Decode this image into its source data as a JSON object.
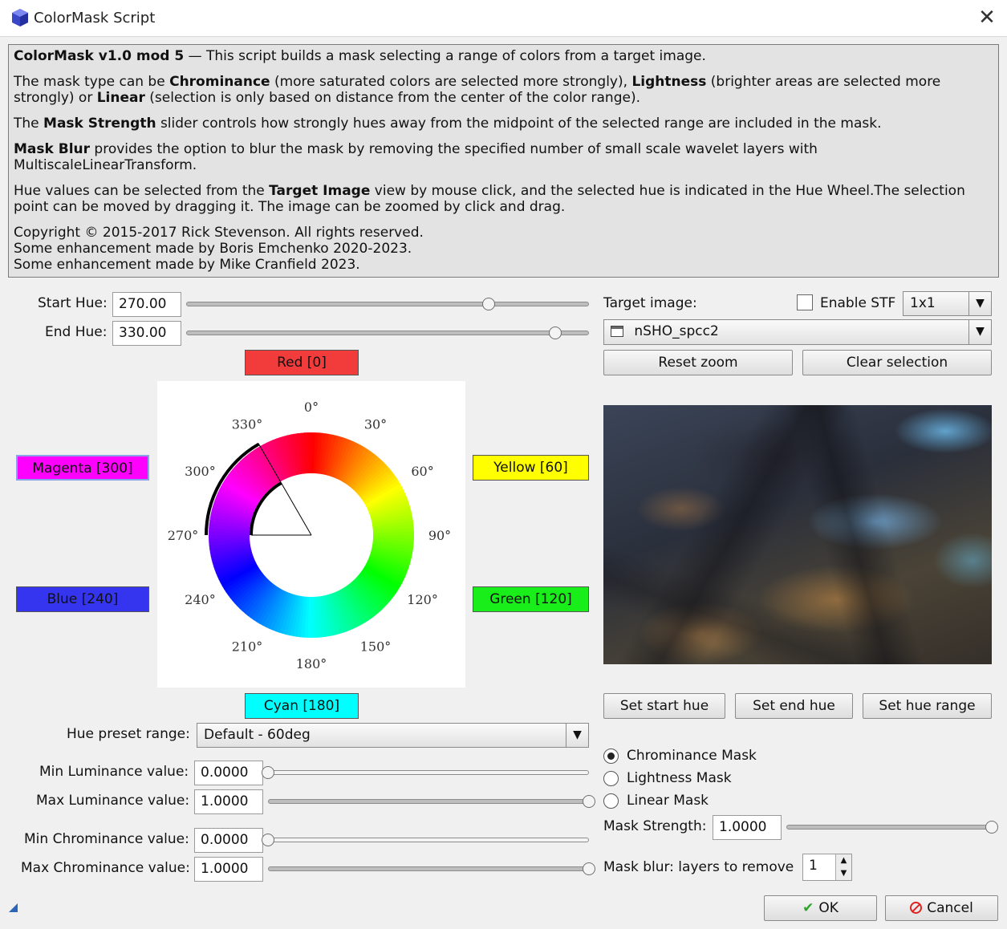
{
  "window": {
    "title": "ColorMask Script",
    "close_glyph": "✕",
    "icon": "app-cube-icon"
  },
  "description": {
    "p1": {
      "b1": "ColorMask v1.0 mod 5",
      "t1": " — This script builds a mask selecting a range of colors from a target image."
    },
    "p2": {
      "t1": "The mask type can be ",
      "b1": "Chrominance",
      "t2": " (more saturated colors are selected more strongly), ",
      "b2": "Lightness",
      "t3": " (brighter areas are selected more strongly) or ",
      "b3": "Linear",
      "t4": " (selection is only based on distance from the center of the color range)."
    },
    "p3": {
      "t1": "The ",
      "b1": "Mask Strength",
      "t2": " slider controls how strongly hues away from the midpoint of the selected range are included in the mask."
    },
    "p4": {
      "b1": "Mask Blur",
      "t1": " provides the option to blur the mask by removing the specified number of small scale wavelet layers with MultiscaleLinearTransform."
    },
    "p5": {
      "t1": "Hue values can be selected from the ",
      "b1": "Target Image",
      "t2": " view by mouse click, and the selected hue is indicated in the Hue Wheel.The selection point can be moved by dragging it. The image can be zoomed by click and drag."
    },
    "p6": {
      "l1": "Copyright © 2015-2017 Rick Stevenson. All rights reserved.",
      "l2": "Some enhancement made by Boris Emchenko 2020-2023.",
      "l3": "Some enhancement made by Mike Cranfield 2023."
    }
  },
  "hue": {
    "start_label": "Start Hue:",
    "start_value": "270.00",
    "start_position": 0.75,
    "end_label": "End Hue:",
    "end_value": "330.00",
    "end_position": 0.9167
  },
  "hue_buttons": {
    "red": {
      "label": "Red [0]",
      "color": "#f23b3b"
    },
    "yellow": {
      "label": "Yellow [60]",
      "color": "#ffff00"
    },
    "green": {
      "label": "Green [120]",
      "color": "#1aee1a"
    },
    "cyan": {
      "label": "Cyan [180]",
      "color": "#00ffff"
    },
    "blue": {
      "label": "Blue [240]",
      "color": "#3535f0"
    },
    "magenta": {
      "label": "Magenta [300]",
      "color": "#ff00ff"
    }
  },
  "wheel": {
    "labels": [
      "0°",
      "30°",
      "60°",
      "90°",
      "120°",
      "150°",
      "180°",
      "210°",
      "240°",
      "270°",
      "300°",
      "330°"
    ],
    "selection_start": 270,
    "selection_end": 330
  },
  "preset": {
    "label": "Hue preset range:",
    "value": "Default - 60deg"
  },
  "luminance": {
    "min_label": "Min Luminance value:",
    "min_value": "0.0000",
    "min_position": 0,
    "max_label": "Max Luminance value:",
    "max_value": "1.0000",
    "max_position": 1
  },
  "chrominance": {
    "min_label": "Min Chrominance value:",
    "min_value": "0.0000",
    "min_position": 0,
    "max_label": "Max Chrominance value:",
    "max_value": "1.0000",
    "max_position": 1
  },
  "target": {
    "label": "Target image:",
    "stf_label": "Enable STF",
    "stf_checked": false,
    "zoom_value": "1x1",
    "image_name": "nSHO_spcc2",
    "reset_zoom": "Reset zoom",
    "clear_selection": "Clear selection"
  },
  "hue_actions": {
    "set_start": "Set start hue",
    "set_end": "Set end hue",
    "set_range": "Set hue range"
  },
  "mask_type": {
    "options": [
      "Chrominance Mask",
      "Lightness Mask",
      "Linear Mask"
    ],
    "selected": 0
  },
  "mask_strength": {
    "label": "Mask Strength:",
    "value": "1.0000",
    "position": 1
  },
  "mask_blur": {
    "label": "Mask blur: layers to remove",
    "value": "1"
  },
  "footer": {
    "ok": "OK",
    "cancel": "Cancel",
    "ok_icon": "check-icon",
    "cancel_icon": "no-entry-icon"
  }
}
